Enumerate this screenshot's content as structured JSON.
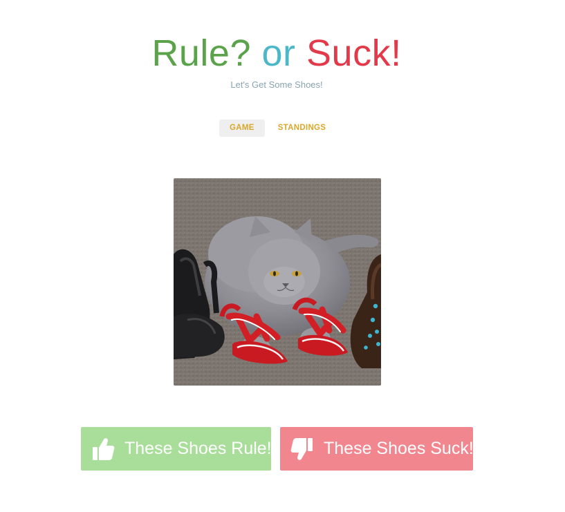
{
  "header": {
    "title_part1": "Rule?",
    "title_part2": "or",
    "title_part3": "Suck!",
    "subtitle": "Let's Get Some Shoes!"
  },
  "nav": {
    "tabs": [
      {
        "label": "GAME",
        "active": true
      },
      {
        "label": "STANDINGS",
        "active": false
      }
    ]
  },
  "colors": {
    "title_green": "#5aa34a",
    "title_blue": "#4bb8c9",
    "title_red": "#e23a4a",
    "nav_gold": "#d9a82b",
    "rule_button": "#a9dd9a",
    "suck_button": "#f1868f"
  },
  "photo": {
    "subject": "cat-wearing-red-shoes-photo"
  },
  "actions": {
    "rule_label": "These Shoes Rule!",
    "rule_icon": "thumbs-up-icon",
    "suck_label": "These Shoes Suck!",
    "suck_icon": "thumbs-down-icon"
  }
}
